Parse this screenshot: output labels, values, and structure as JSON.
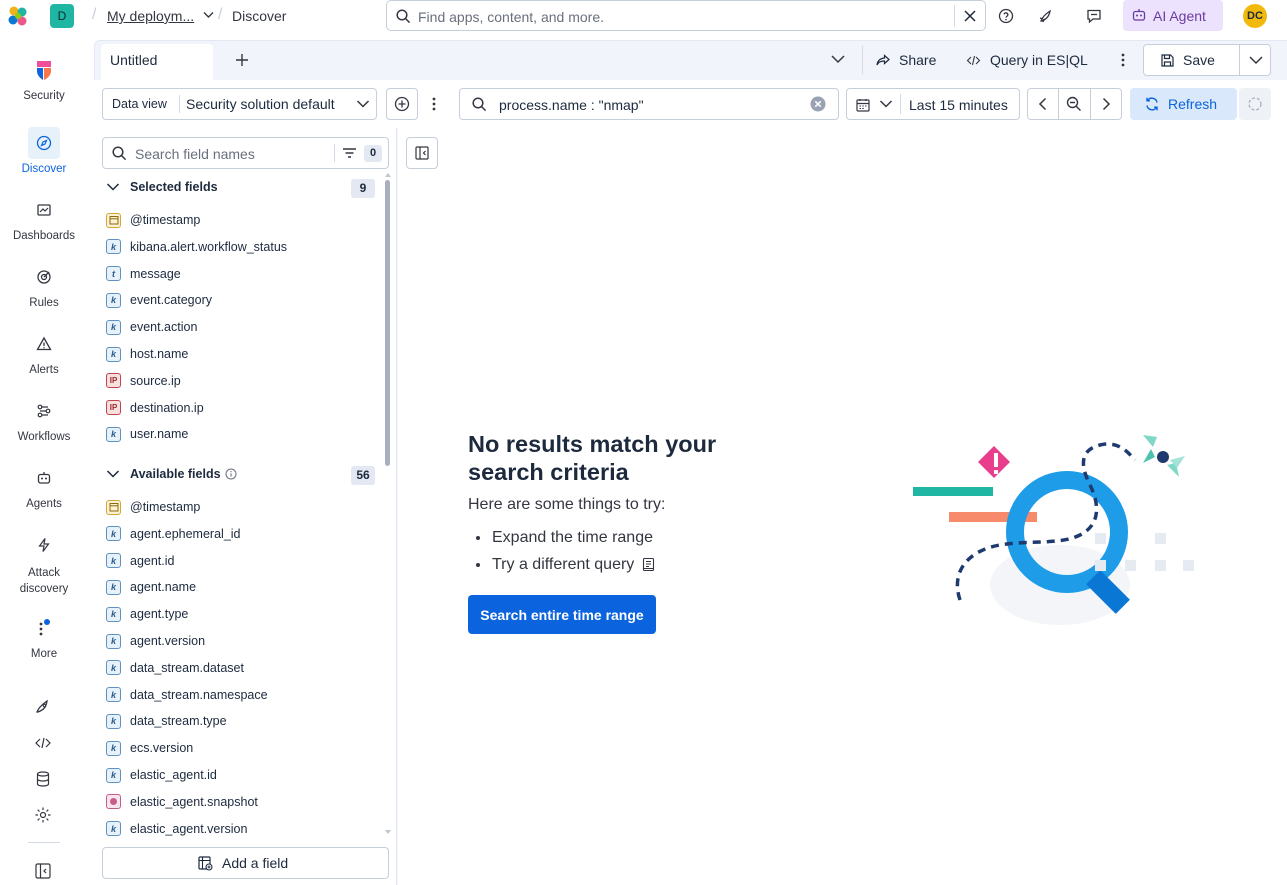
{
  "header": {
    "space_initial": "D",
    "deployment_label": "My deploym...",
    "page_label": "Discover",
    "search_placeholder": "Find apps, content, and more.",
    "ai_agent_label": "AI Agent",
    "user_initials": "DC"
  },
  "nav": {
    "items": [
      {
        "label": "Security"
      },
      {
        "label": "Discover"
      },
      {
        "label": "Dashboards"
      },
      {
        "label": "Rules"
      },
      {
        "label": "Alerts"
      },
      {
        "label": "Workflows"
      },
      {
        "label": "Agents"
      },
      {
        "label": "Attack discovery"
      },
      {
        "label": "More"
      }
    ]
  },
  "tabs": {
    "active_tab": "Untitled"
  },
  "toolbar": {
    "share_label": "Share",
    "esql_label": "Query in ES|QL",
    "save_label": "Save",
    "dataview_prefix": "Data view",
    "dataview_value": "Security solution default",
    "query_value": "process.name : \"nmap\"",
    "time_label": "Last 15 minutes",
    "refresh_label": "Refresh"
  },
  "sidebar": {
    "search_placeholder": "Search field names",
    "filter_count": "0",
    "selected_title": "Selected fields",
    "selected_count": "9",
    "selected_fields": [
      {
        "type": "date",
        "name": "@timestamp"
      },
      {
        "type": "k",
        "name": "kibana.alert.workflow_status"
      },
      {
        "type": "t",
        "name": "message"
      },
      {
        "type": "k",
        "name": "event.category"
      },
      {
        "type": "k",
        "name": "event.action"
      },
      {
        "type": "k",
        "name": "host.name"
      },
      {
        "type": "ip",
        "name": "source.ip"
      },
      {
        "type": "ip",
        "name": "destination.ip"
      },
      {
        "type": "k",
        "name": "user.name"
      }
    ],
    "available_title": "Available fields",
    "available_count": "56",
    "available_fields": [
      {
        "type": "date",
        "name": "@timestamp"
      },
      {
        "type": "k",
        "name": "agent.ephemeral_id"
      },
      {
        "type": "k",
        "name": "agent.id"
      },
      {
        "type": "k",
        "name": "agent.name"
      },
      {
        "type": "k",
        "name": "agent.type"
      },
      {
        "type": "k",
        "name": "agent.version"
      },
      {
        "type": "k",
        "name": "data_stream.dataset"
      },
      {
        "type": "k",
        "name": "data_stream.namespace"
      },
      {
        "type": "k",
        "name": "data_stream.type"
      },
      {
        "type": "k",
        "name": "ecs.version"
      },
      {
        "type": "k",
        "name": "elastic_agent.id"
      },
      {
        "type": "version",
        "name": "elastic_agent.snapshot"
      },
      {
        "type": "k",
        "name": "elastic_agent.version"
      }
    ],
    "add_field_label": "Add a field",
    "token_text": {
      "k": "k",
      "t": "t",
      "ip": "IP"
    }
  },
  "empty_state": {
    "title": "No results match your search criteria",
    "subtitle": "Here are some things to try:",
    "tips": [
      "Expand the time range",
      "Try a different query"
    ],
    "cta_label": "Search entire time range"
  },
  "colors": {
    "primary": "#0b64dd",
    "ai_agent_bg": "#ece2fe",
    "refresh_bg": "#d9e8fb"
  }
}
